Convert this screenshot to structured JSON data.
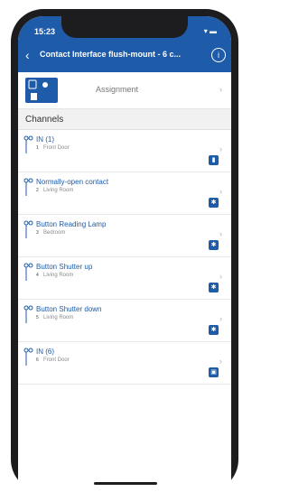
{
  "status": {
    "time": "15:23",
    "icons": "▾ ▬"
  },
  "header": {
    "back": "‹",
    "title": "Contact Interface flush-mount - 6 c...",
    "info": "i"
  },
  "assignment": {
    "label": "Assignment",
    "chevron": "›"
  },
  "section": {
    "title": "Channels"
  },
  "channels": [
    {
      "name": "IN (1)",
      "number": "1",
      "room": "Front Door",
      "icon": "door-sensor-icon"
    },
    {
      "name": "Normally-open contact",
      "number": "2",
      "room": "Living Room",
      "icon": "sensor-icon"
    },
    {
      "name": "Button Reading Lamp",
      "number": "3",
      "room": "Bedroom",
      "icon": "sensor-icon"
    },
    {
      "name": "Button Shutter up",
      "number": "4",
      "room": "Living Room",
      "icon": "sensor-icon"
    },
    {
      "name": "Button Shutter down",
      "number": "5",
      "room": "Living Room",
      "icon": "sensor-icon"
    },
    {
      "name": "IN (6)",
      "number": "6",
      "room": "Front Door",
      "icon": "lock-icon"
    }
  ],
  "colors": {
    "accent": "#1e5ba8",
    "sectionBg": "#f1f1f1"
  }
}
